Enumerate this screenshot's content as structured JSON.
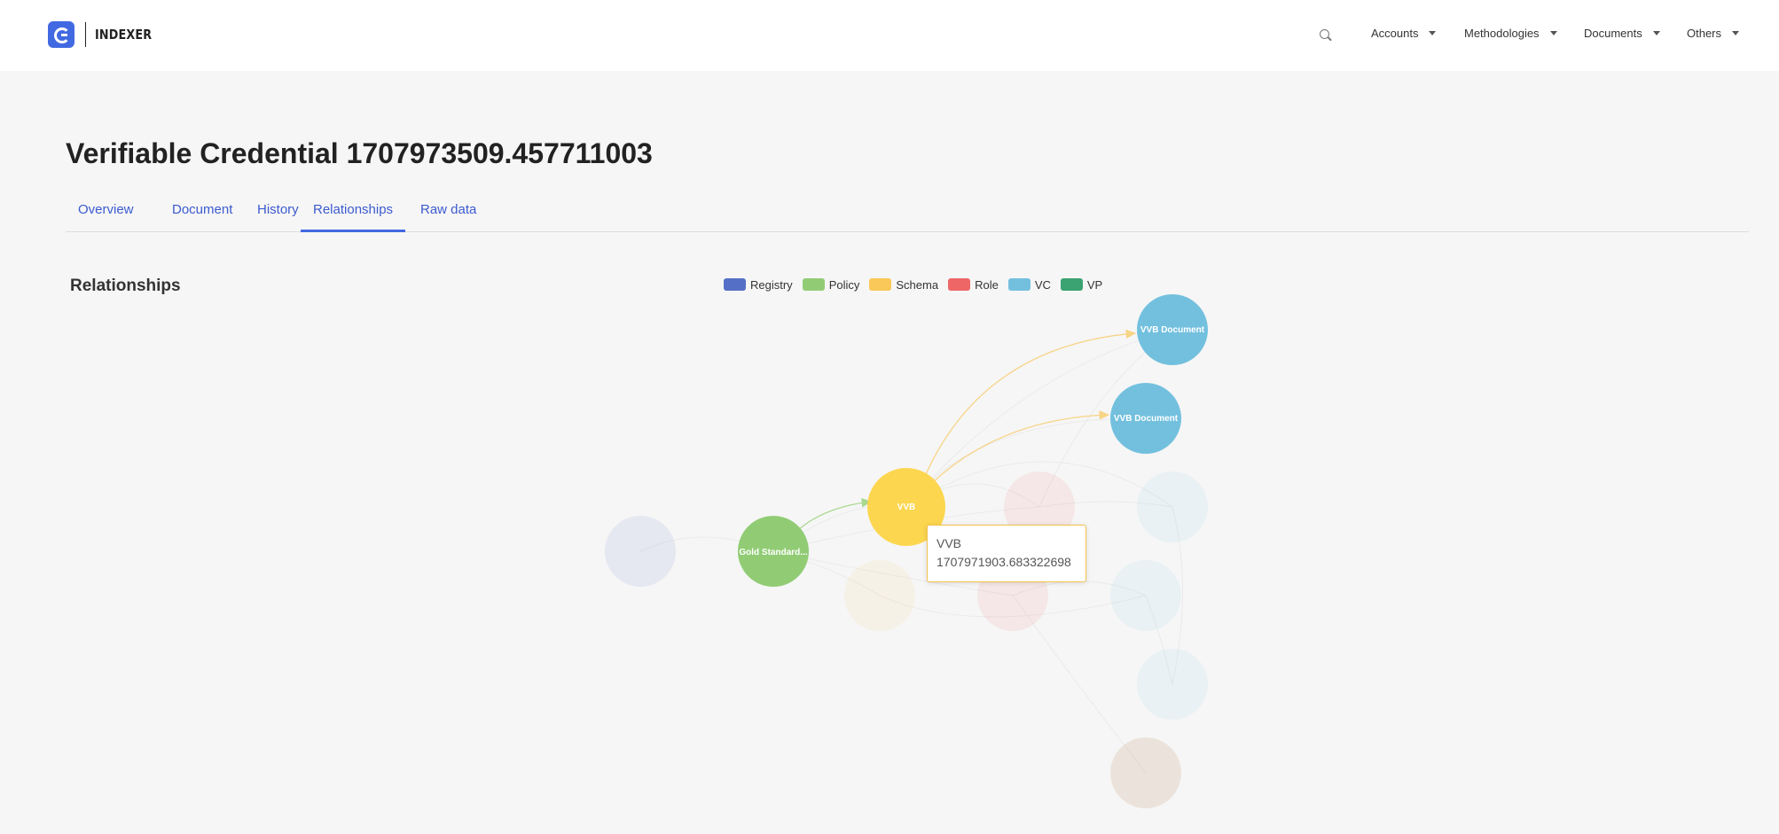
{
  "header": {
    "logo_text": "INDEXER",
    "nav": [
      {
        "label": "Accounts"
      },
      {
        "label": "Methodologies"
      },
      {
        "label": "Documents"
      },
      {
        "label": "Others"
      }
    ]
  },
  "page": {
    "title": "Verifiable Credential 1707973509.457711003",
    "tabs": [
      {
        "label": "Overview"
      },
      {
        "label": "Document"
      },
      {
        "label": "History"
      },
      {
        "label": "Relationships"
      },
      {
        "label": "Raw data"
      }
    ],
    "active_tab": "Relationships",
    "section_title": "Relationships"
  },
  "legend": [
    {
      "label": "Registry",
      "color": "#5470c6"
    },
    {
      "label": "Policy",
      "color": "#91cc75"
    },
    {
      "label": "Schema",
      "color": "#fac858"
    },
    {
      "label": "Role",
      "color": "#ee6666"
    },
    {
      "label": "VC",
      "color": "#73c0de"
    },
    {
      "label": "VP",
      "color": "#3ba272"
    }
  ],
  "graph": {
    "nodes": [
      {
        "id": "registry",
        "type": "Registry",
        "label": "",
        "dim": true
      },
      {
        "id": "policy",
        "type": "Policy",
        "label": "Gold Standard...",
        "dim": false
      },
      {
        "id": "schema-vvb",
        "type": "Schema",
        "label": "VVB",
        "dim": false
      },
      {
        "id": "schema-2",
        "type": "Schema",
        "label": "",
        "dim": true
      },
      {
        "id": "role-1",
        "type": "Role",
        "label": "",
        "dim": true
      },
      {
        "id": "role-2",
        "type": "Role",
        "label": "",
        "dim": true
      },
      {
        "id": "vc-vvb-1",
        "type": "VC",
        "label": "VVB Document",
        "dim": false
      },
      {
        "id": "vc-vvb-2",
        "type": "VC",
        "label": "VVB Document",
        "dim": false
      },
      {
        "id": "vc-3",
        "type": "VC",
        "label": "",
        "dim": true
      },
      {
        "id": "vc-4",
        "type": "VC",
        "label": "",
        "dim": true
      },
      {
        "id": "vc-5",
        "type": "VC",
        "label": "",
        "dim": true
      },
      {
        "id": "other",
        "type": "Other",
        "label": "",
        "dim": true
      }
    ]
  },
  "tooltip": {
    "line1": "VVB",
    "line2": "1707971903.683322698"
  }
}
